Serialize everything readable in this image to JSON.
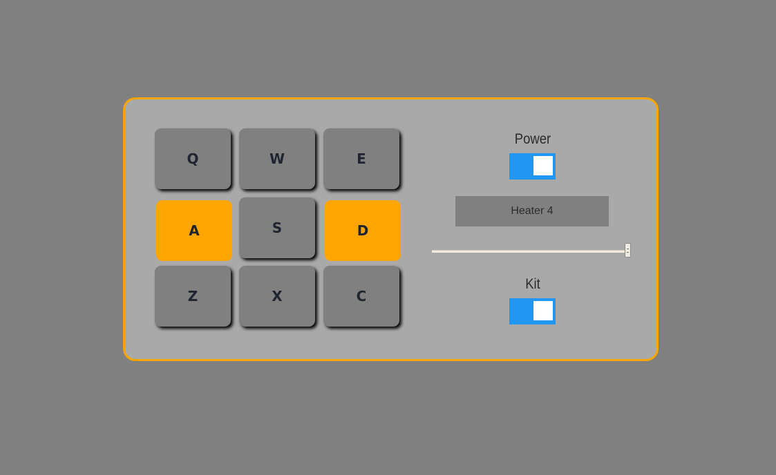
{
  "pads": [
    {
      "key": "Q",
      "active": false
    },
    {
      "key": "W",
      "active": false
    },
    {
      "key": "E",
      "active": false
    },
    {
      "key": "A",
      "active": true
    },
    {
      "key": "S",
      "active": false
    },
    {
      "key": "D",
      "active": true
    },
    {
      "key": "Z",
      "active": false
    },
    {
      "key": "X",
      "active": false
    },
    {
      "key": "C",
      "active": false
    }
  ],
  "controls": {
    "power_label": "Power",
    "power_on": true,
    "display_text": "Heater 4",
    "volume": 1.0,
    "kit_label": "Kit",
    "kit_on": true
  },
  "colors": {
    "background": "#808080",
    "panel": "#a9a9a9",
    "accent": "#ffa500",
    "toggle": "#2196f3"
  }
}
